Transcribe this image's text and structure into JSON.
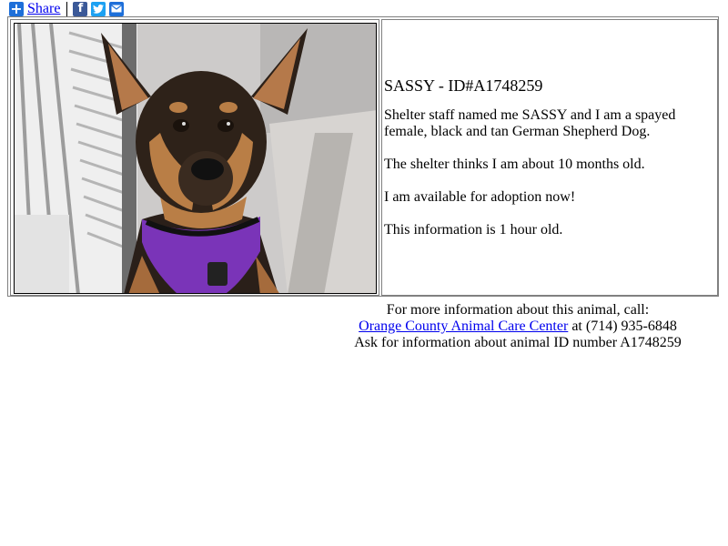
{
  "share_bar": {
    "label": "Share",
    "icons": [
      "share-plus-icon",
      "facebook-icon",
      "twitter-icon",
      "email-icon"
    ],
    "colors": {
      "share": "#1e6fd9",
      "facebook": "#3b5998",
      "twitter": "#1da1f2",
      "email": "#1e6fd9"
    }
  },
  "animal": {
    "title": "SASSY - ID#A1748259",
    "paragraphs": [
      "Shelter staff named me SASSY and I am a spayed female, black and tan German Shepherd Dog.",
      "The shelter thinks I am about 10 months old.",
      "I am available for adoption now!",
      "This information is 1 hour old."
    ]
  },
  "contact": {
    "line1": "For more information about this animal, call:",
    "center_name": "Orange County Animal Care Center",
    "phone_text": "at (714) 935-6848",
    "line3": "Ask for information about animal ID number A1748259"
  },
  "colors": {
    "link": "#0000ee",
    "border": "#808080"
  }
}
